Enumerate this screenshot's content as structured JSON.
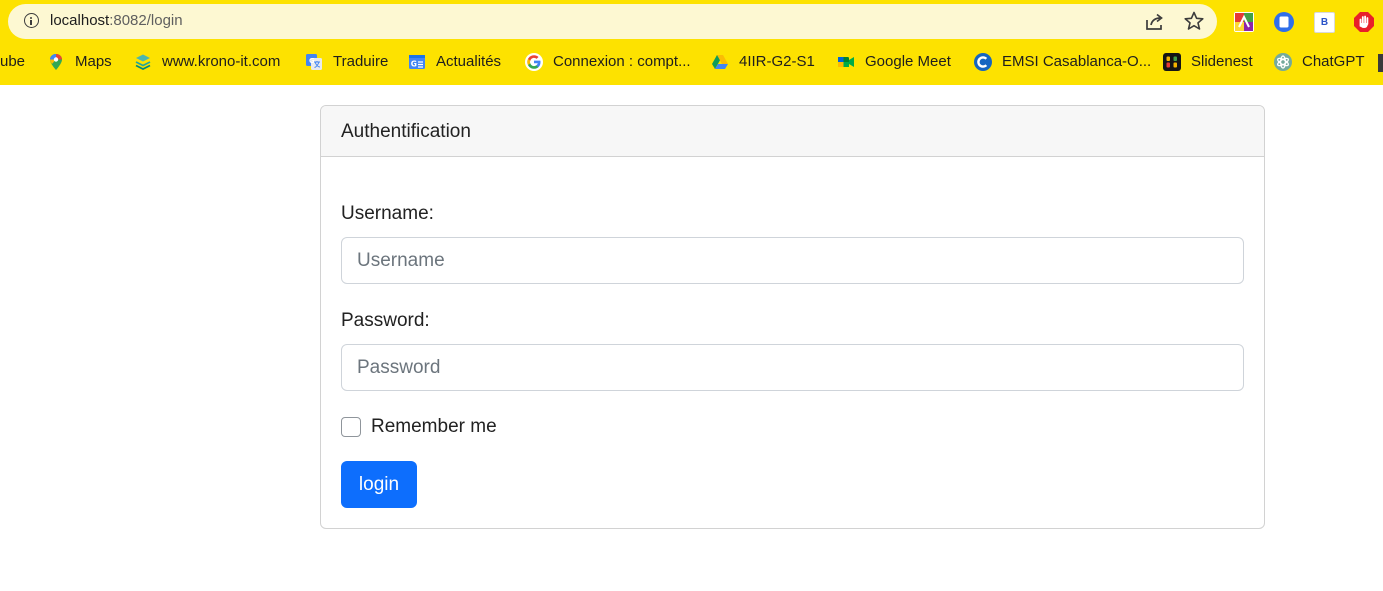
{
  "browser": {
    "url_host": "localhost",
    "url_rest": ":8082/login",
    "extension_b_label": "B"
  },
  "bookmarks": [
    {
      "label": "ube",
      "icon": "youtube-icon"
    },
    {
      "label": "Maps",
      "icon": "maps-pin-icon"
    },
    {
      "label": "www.krono-it.com",
      "icon": "krono-layers-icon"
    },
    {
      "label": "Traduire",
      "icon": "translate-icon"
    },
    {
      "label": "Actualités",
      "icon": "news-icon"
    },
    {
      "label": "Connexion : compt...",
      "icon": "google-g-icon"
    },
    {
      "label": "4IIR-G2-S1",
      "icon": "drive-icon"
    },
    {
      "label": "Google Meet",
      "icon": "meet-icon"
    },
    {
      "label": "EMSI Casablanca-O...",
      "icon": "emsi-icon"
    },
    {
      "label": "Slidenest",
      "icon": "slidenest-icon"
    },
    {
      "label": "ChatGPT",
      "icon": "chatgpt-icon"
    }
  ],
  "card": {
    "title": "Authentification",
    "username_label": "Username:",
    "username_placeholder": "Username",
    "username_value": "",
    "password_label": "Password:",
    "password_placeholder": "Password",
    "password_value": "",
    "remember_label": "Remember me",
    "remember_checked": false,
    "login_label": "login"
  },
  "colors": {
    "chrome_bg": "#fde200",
    "primary_button": "#0d6efd"
  }
}
